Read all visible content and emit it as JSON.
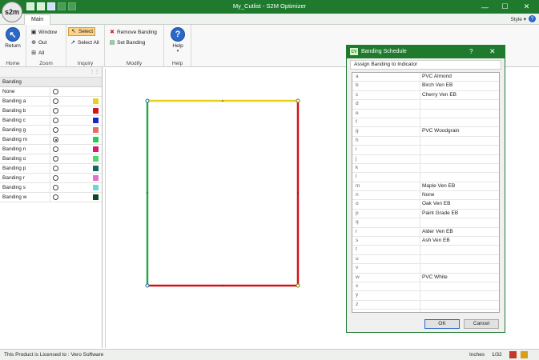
{
  "app": {
    "logo_text": "s2m",
    "title": "My_Cutlist - S2M Optimizer"
  },
  "ribbon": {
    "tab_main": "Main",
    "style_menu": "Style",
    "groups": {
      "home": {
        "label": "Home",
        "return_label": "Return"
      },
      "zoom": {
        "label": "Zoom",
        "window_label": "Window",
        "out_label": "Out",
        "all_label": "All"
      },
      "inquiry": {
        "label": "Inquiry",
        "select_label": "Select",
        "select_all_label": "Select All"
      },
      "modify": {
        "label": "Modify",
        "remove_banding_label": "Remove Banding",
        "set_banding_label": "Set Banding"
      },
      "help": {
        "label": "Help",
        "help_label": "Help"
      }
    }
  },
  "banding_panel": {
    "header": "Banding",
    "rows": [
      {
        "name": "None",
        "selected": false,
        "color": null
      },
      {
        "name": "Banding a",
        "selected": false,
        "color": "#e6d21c"
      },
      {
        "name": "Banding b",
        "selected": false,
        "color": "#d6121b"
      },
      {
        "name": "Banding c",
        "selected": false,
        "color": "#1b25c8"
      },
      {
        "name": "Banding g",
        "selected": false,
        "color": "#e56b67"
      },
      {
        "name": "Banding m",
        "selected": true,
        "color": "#22d04c"
      },
      {
        "name": "Banding n",
        "selected": false,
        "color": "#d81b6e"
      },
      {
        "name": "Banding o",
        "selected": false,
        "color": "#4fd86a"
      },
      {
        "name": "Banding p",
        "selected": false,
        "color": "#0f6b5a"
      },
      {
        "name": "Banding r",
        "selected": false,
        "color": "#e36fd0"
      },
      {
        "name": "Banding s",
        "selected": false,
        "color": "#6ad6d9"
      },
      {
        "name": "Banding w",
        "selected": false,
        "color": "#0b4a1d"
      }
    ]
  },
  "drawing": {
    "edge_colors": {
      "top": "#e6d21c",
      "right": "#d6121b",
      "bottom": "#d6121b",
      "left": "#2aa84a"
    }
  },
  "dialog": {
    "icon_text": "CV",
    "title": "Banding Schedule",
    "help_glyph": "?",
    "close_glyph": "✕",
    "subheader": "Assign Banding to Indicator",
    "rows": [
      {
        "key": "a",
        "value": "PVC Almond"
      },
      {
        "key": "b",
        "value": "Birch Ven EB"
      },
      {
        "key": "c",
        "value": "Cherry Ven EB"
      },
      {
        "key": "d",
        "value": ""
      },
      {
        "key": "e",
        "value": ""
      },
      {
        "key": "f",
        "value": ""
      },
      {
        "key": "g",
        "value": "PVC Woodgrain"
      },
      {
        "key": "h",
        "value": ""
      },
      {
        "key": "i",
        "value": ""
      },
      {
        "key": "j",
        "value": ""
      },
      {
        "key": "k",
        "value": ""
      },
      {
        "key": "l",
        "value": ""
      },
      {
        "key": "m",
        "value": "Maple Ven EB"
      },
      {
        "key": "n",
        "value": "None"
      },
      {
        "key": "o",
        "value": "Oak Ven EB"
      },
      {
        "key": "p",
        "value": "Paint Grade EB"
      },
      {
        "key": "q",
        "value": ""
      },
      {
        "key": "r",
        "value": "Alder Ven EB"
      },
      {
        "key": "s",
        "value": "Ash Ven EB"
      },
      {
        "key": "t",
        "value": ""
      },
      {
        "key": "u",
        "value": ""
      },
      {
        "key": "v",
        "value": ""
      },
      {
        "key": "w",
        "value": "PVC White"
      },
      {
        "key": "x",
        "value": ""
      },
      {
        "key": "y",
        "value": ""
      },
      {
        "key": "z",
        "value": ""
      }
    ],
    "ok_label": "OK",
    "cancel_label": "Cancel"
  },
  "status": {
    "license_text": "This Product is Licensed to : Vero Software",
    "units": "Inches",
    "fraction": "1/32"
  }
}
